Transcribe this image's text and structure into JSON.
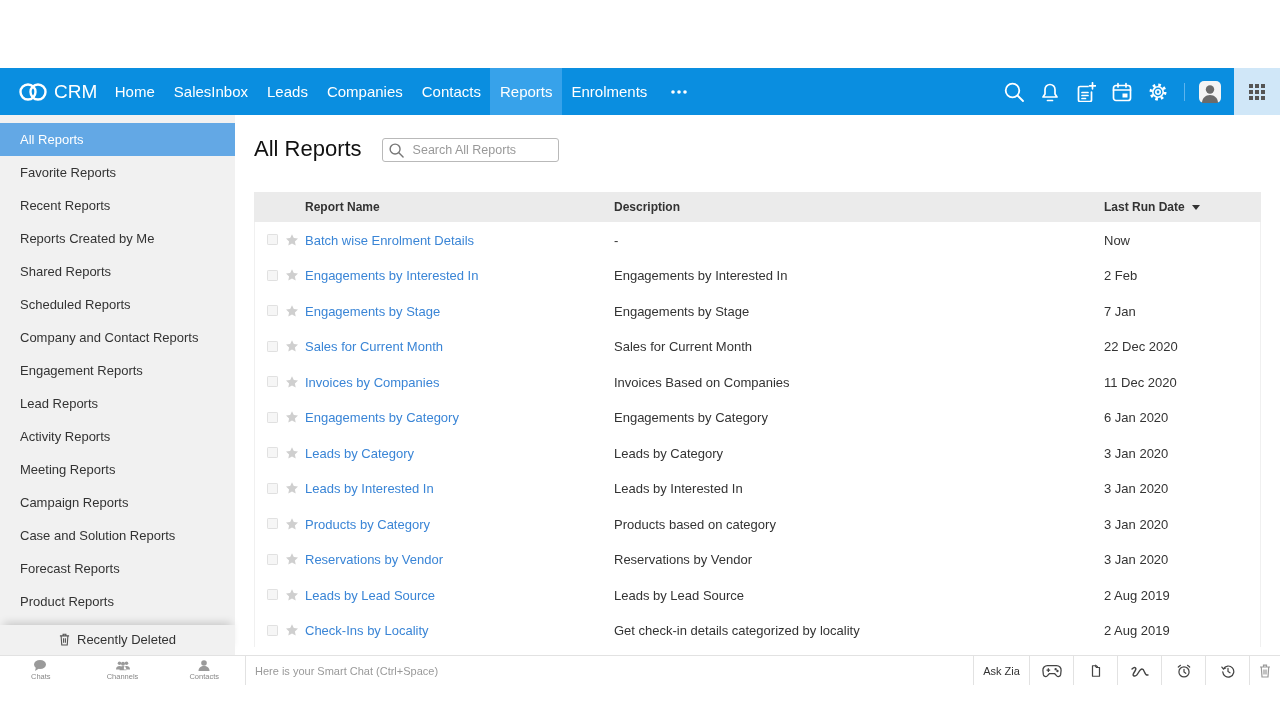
{
  "top_nav": {
    "logo": "CRM",
    "tabs": [
      {
        "label": "Home",
        "selected": false
      },
      {
        "label": "SalesInbox",
        "selected": false
      },
      {
        "label": "Leads",
        "selected": false
      },
      {
        "label": "Companies",
        "selected": false
      },
      {
        "label": "Contacts",
        "selected": false
      },
      {
        "label": "Reports",
        "selected": true
      },
      {
        "label": "Enrolments",
        "selected": false
      }
    ]
  },
  "sidebar": {
    "items": [
      {
        "label": "All Reports",
        "selected": true
      },
      {
        "label": "Favorite Reports",
        "selected": false
      },
      {
        "label": "Recent Reports",
        "selected": false
      },
      {
        "label": "Reports Created by Me",
        "selected": false
      },
      {
        "label": "Shared Reports",
        "selected": false
      },
      {
        "label": "Scheduled Reports",
        "selected": false
      },
      {
        "label": "Company and Contact Reports",
        "selected": false
      },
      {
        "label": "Engagement Reports",
        "selected": false
      },
      {
        "label": "Lead Reports",
        "selected": false
      },
      {
        "label": "Activity Reports",
        "selected": false
      },
      {
        "label": "Meeting Reports",
        "selected": false
      },
      {
        "label": "Campaign Reports",
        "selected": false
      },
      {
        "label": "Case and Solution Reports",
        "selected": false
      },
      {
        "label": "Forecast Reports",
        "selected": false
      },
      {
        "label": "Product Reports",
        "selected": false
      }
    ],
    "footer": "Recently Deleted"
  },
  "content": {
    "title": "All Reports",
    "search": {
      "placeholder": "Search All Reports"
    }
  },
  "table": {
    "columns": [
      {
        "label": "Report Name",
        "sorted": false
      },
      {
        "label": "Description",
        "sorted": false
      },
      {
        "label": "Last Run Date",
        "sorted": true
      }
    ],
    "rows": [
      {
        "name": "Batch wise Enrolment Details",
        "description": "-",
        "last_run": "Now",
        "checked": false,
        "starred": false
      },
      {
        "name": "Engagements by Interested In",
        "description": "Engagements by Interested In",
        "last_run": "2 Feb",
        "checked": false,
        "starred": false
      },
      {
        "name": "Engagements by Stage",
        "description": "Engagements by Stage",
        "last_run": "7 Jan",
        "checked": false,
        "starred": false
      },
      {
        "name": "Sales for Current Month",
        "description": "Sales for Current Month",
        "last_run": "22 Dec 2020",
        "checked": false,
        "starred": false
      },
      {
        "name": "Invoices by Companies",
        "description": "Invoices Based on Companies",
        "last_run": "11 Dec 2020",
        "checked": false,
        "starred": false
      },
      {
        "name": "Engagements by Category",
        "description": "Engagements by Category",
        "last_run": "6 Jan 2020",
        "checked": false,
        "starred": false
      },
      {
        "name": "Leads by Category",
        "description": "Leads by Category",
        "last_run": "3 Jan 2020",
        "checked": false,
        "starred": false
      },
      {
        "name": "Leads by Interested In",
        "description": "Leads by Interested In",
        "last_run": "3 Jan 2020",
        "checked": false,
        "starred": false
      },
      {
        "name": "Products by Category",
        "description": "Products based on category",
        "last_run": "3 Jan 2020",
        "checked": false,
        "starred": false
      },
      {
        "name": "Reservations by Vendor",
        "description": "Reservations by Vendor",
        "last_run": "3 Jan 2020",
        "checked": false,
        "starred": false
      },
      {
        "name": "Leads by Lead Source",
        "description": "Leads by Lead Source",
        "last_run": "2 Aug 2019",
        "checked": false,
        "starred": false
      },
      {
        "name": "Check-Ins by Locality",
        "description": "Get check-in details categorized by locality",
        "last_run": "2 Aug 2019",
        "checked": false,
        "starred": false
      }
    ]
  },
  "chat_bar": {
    "tabs": [
      {
        "label": "Chats"
      },
      {
        "label": "Channels"
      },
      {
        "label": "Contacts"
      }
    ],
    "input": {
      "placeholder": "Here is your Smart Chat (Ctrl+Space)"
    },
    "ask_zia": "Ask Zia"
  }
}
